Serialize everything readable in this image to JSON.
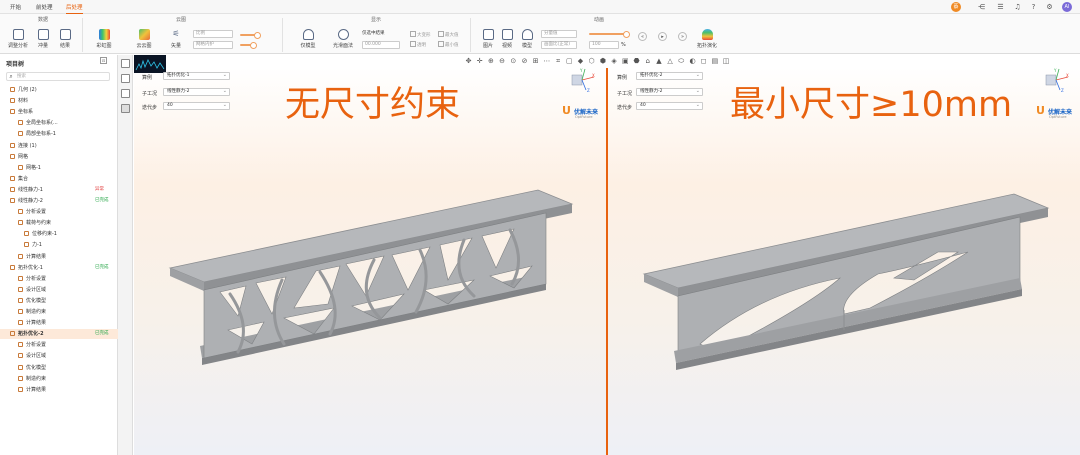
{
  "tabs": [
    {
      "label": "开始"
    },
    {
      "label": "前处理"
    },
    {
      "label": "后处理"
    }
  ],
  "ribbon": {
    "groups": [
      {
        "title": "数据"
      },
      {
        "title": "云图"
      },
      {
        "title": "显示"
      },
      {
        "title": "动画"
      }
    ],
    "data_buttons": [
      {
        "label": "调整分析"
      },
      {
        "label": "冲量"
      },
      {
        "label": "结果"
      }
    ],
    "cloud_buttons": [
      {
        "label": "彩虹图"
      },
      {
        "label": "云云图"
      },
      {
        "label": "矢量"
      }
    ],
    "cloud_selects": [
      "比例",
      "网格内护"
    ],
    "display_buttons": [
      {
        "label": "仅模型"
      },
      {
        "label": "光滑面法"
      }
    ],
    "display_select_label": "仅选中结果",
    "display_select_value": "00.000",
    "display_checks": [
      "大变形",
      "最大值",
      "透明",
      "最小值"
    ],
    "anim_buttons": [
      {
        "label": "图片"
      },
      {
        "label": "视频"
      },
      {
        "label": "模型"
      },
      {
        "label": "拓扑演化"
      }
    ],
    "anim_selects": [
      "分量值",
      "画面比(正常)"
    ],
    "anim_speed": "100",
    "anim_unit": "%"
  },
  "tree": {
    "title": "项目树",
    "search_placeholder": "搜索",
    "nodes": [
      {
        "label": "几何 (2)"
      },
      {
        "label": "材料"
      },
      {
        "label": "坐标系"
      },
      {
        "label": "全局坐标系(..."
      },
      {
        "label": "局部坐标系-1"
      },
      {
        "label": "连接 (1)"
      },
      {
        "label": "网格"
      },
      {
        "label": "网格-1"
      },
      {
        "label": "集合"
      },
      {
        "label": "线性静力-1",
        "status": "异常"
      },
      {
        "label": "线性静力-2",
        "status": "已完成"
      },
      {
        "label": "分析设置"
      },
      {
        "label": "载荷与约束"
      },
      {
        "label": "位移约束-1"
      },
      {
        "label": "力-1"
      },
      {
        "label": "计算结果"
      },
      {
        "label": "拓扑优化-1",
        "status": "已完成"
      },
      {
        "label": "分析设置"
      },
      {
        "label": "设计区域"
      },
      {
        "label": "优化模型"
      },
      {
        "label": "制造约束"
      },
      {
        "label": "计算结果"
      },
      {
        "label": "拓扑优化-2",
        "status": "已完成"
      },
      {
        "label": "分析设置"
      },
      {
        "label": "设计区域"
      },
      {
        "label": "优化模型"
      },
      {
        "label": "制造约束"
      },
      {
        "label": "计算结果"
      }
    ]
  },
  "panes": [
    {
      "labels": {
        "case": "算例",
        "subcase": "子工况",
        "iteration": "迭代步"
      },
      "case_value": "拓扑优化-1",
      "subcase_value": "线性静力-2",
      "iteration_value": "40",
      "title": "无尺寸约束"
    },
    {
      "labels": {
        "case": "算例",
        "subcase": "子工况",
        "iteration": "迭代步"
      },
      "case_value": "拓扑优化-2",
      "subcase_value": "线性静力-2",
      "iteration_value": "40",
      "title": "最小尺寸≥10mm"
    }
  ],
  "logo": {
    "name": "优解未来",
    "sub": "OptFuture"
  },
  "axis_labels": {
    "x": "X",
    "y": "Y",
    "z": "Z"
  },
  "colors": {
    "accent": "#e8620f",
    "model": "#a9abae",
    "logo_blue": "#1763c6"
  }
}
